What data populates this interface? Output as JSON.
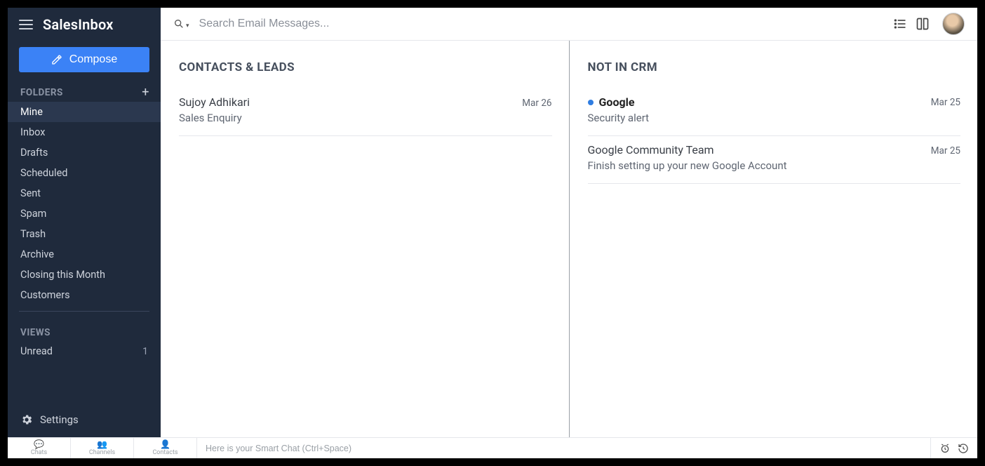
{
  "brand": "SalesInbox",
  "compose_label": "Compose",
  "search": {
    "placeholder": "Search Email Messages..."
  },
  "sidebar": {
    "folders_header": "FOLDERS",
    "folders": [
      {
        "label": "Mine",
        "active": true
      },
      {
        "label": "Inbox"
      },
      {
        "label": "Drafts"
      },
      {
        "label": "Scheduled"
      },
      {
        "label": "Sent"
      },
      {
        "label": "Spam"
      },
      {
        "label": "Trash"
      },
      {
        "label": "Archive"
      },
      {
        "label": "Closing this Month"
      },
      {
        "label": "Customers"
      }
    ],
    "views_header": "VIEWS",
    "views": [
      {
        "label": "Unread",
        "count": "1"
      }
    ],
    "settings_label": "Settings"
  },
  "columns": {
    "left": {
      "title": "CONTACTS & LEADS",
      "messages": [
        {
          "sender": "Sujoy Adhikari",
          "subject": "Sales Enquiry",
          "date": "Mar 26",
          "unread": false
        }
      ]
    },
    "right": {
      "title": "NOT IN CRM",
      "messages": [
        {
          "sender": "Google",
          "subject": "Security alert",
          "date": "Mar 25",
          "unread": true
        },
        {
          "sender": "Google Community Team",
          "subject": "Finish setting up your new Google Account",
          "date": "Mar 25",
          "unread": false
        }
      ]
    }
  },
  "bottombar": {
    "tabs": [
      {
        "label": "Chats"
      },
      {
        "label": "Channels"
      },
      {
        "label": "Contacts"
      }
    ],
    "smartchat_placeholder": "Here is your Smart Chat (Ctrl+Space)"
  }
}
